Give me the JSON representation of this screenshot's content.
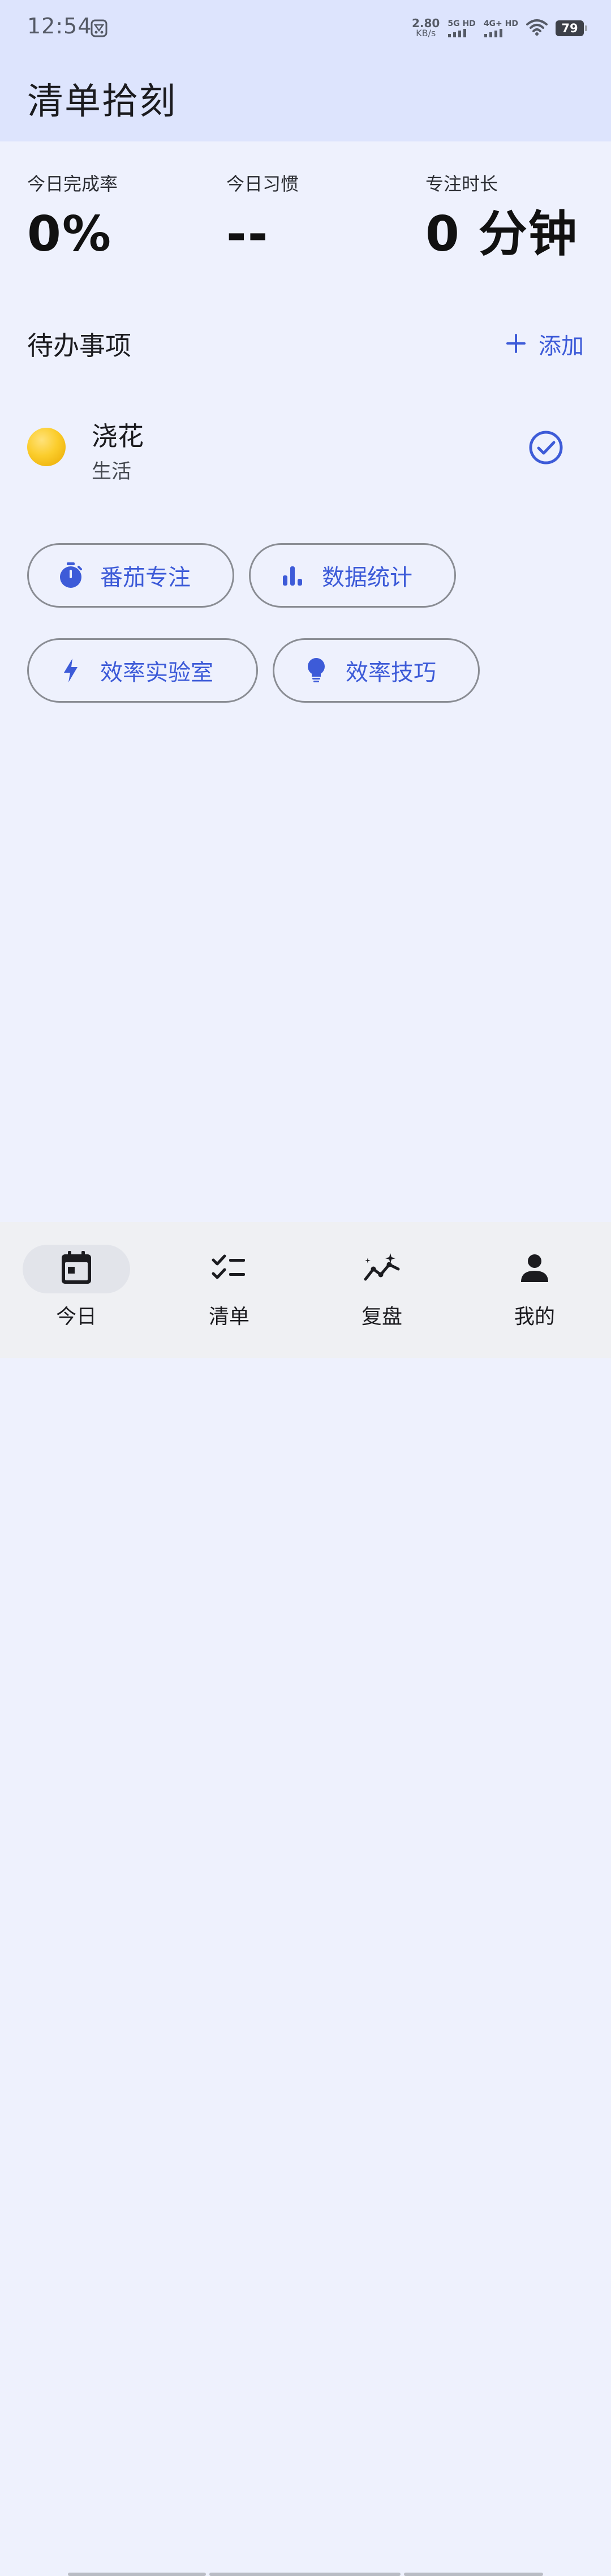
{
  "status_bar": {
    "time": "12:54",
    "net_speed_value": "2.80",
    "net_speed_unit": "KB/s",
    "sim1_label": "5G HD",
    "sim2_label": "4G+ HD",
    "battery": "79",
    "icons": [
      "notification-app-icon",
      "wifi-icon",
      "battery-icon"
    ]
  },
  "app": {
    "title": "清单拾刻"
  },
  "stats": [
    {
      "label": "今日完成率",
      "value": "0%"
    },
    {
      "label": "今日习惯",
      "value": "--"
    },
    {
      "label": "专注时长",
      "value": "0 分钟"
    }
  ],
  "todo": {
    "title": "待办事项",
    "add_label": "添加",
    "add_icon": "plus-icon",
    "tasks": [
      {
        "name": "浇花",
        "category": "生活",
        "dot_color": "#f7c623",
        "check_icon": "check-circle-icon"
      }
    ]
  },
  "actions": [
    {
      "label": "番茄专注",
      "icon": "stopwatch-icon"
    },
    {
      "label": "数据统计",
      "icon": "bar-chart-icon"
    },
    {
      "label": "效率实验室",
      "icon": "lightning-icon"
    },
    {
      "label": "效率技巧",
      "icon": "lightbulb-icon"
    }
  ],
  "bottom_nav": {
    "items": [
      {
        "label": "今日",
        "icon": "calendar-icon",
        "active": true
      },
      {
        "label": "清单",
        "icon": "checklist-icon",
        "active": false
      },
      {
        "label": "复盘",
        "icon": "trend-sparkle-icon",
        "active": false
      },
      {
        "label": "我的",
        "icon": "person-icon",
        "active": false
      }
    ]
  },
  "colors": {
    "accent": "#3d5bd8",
    "header_bg": "#dde4fd",
    "page_bg": "#eef1fd",
    "nav_bg": "#eff0f3"
  }
}
